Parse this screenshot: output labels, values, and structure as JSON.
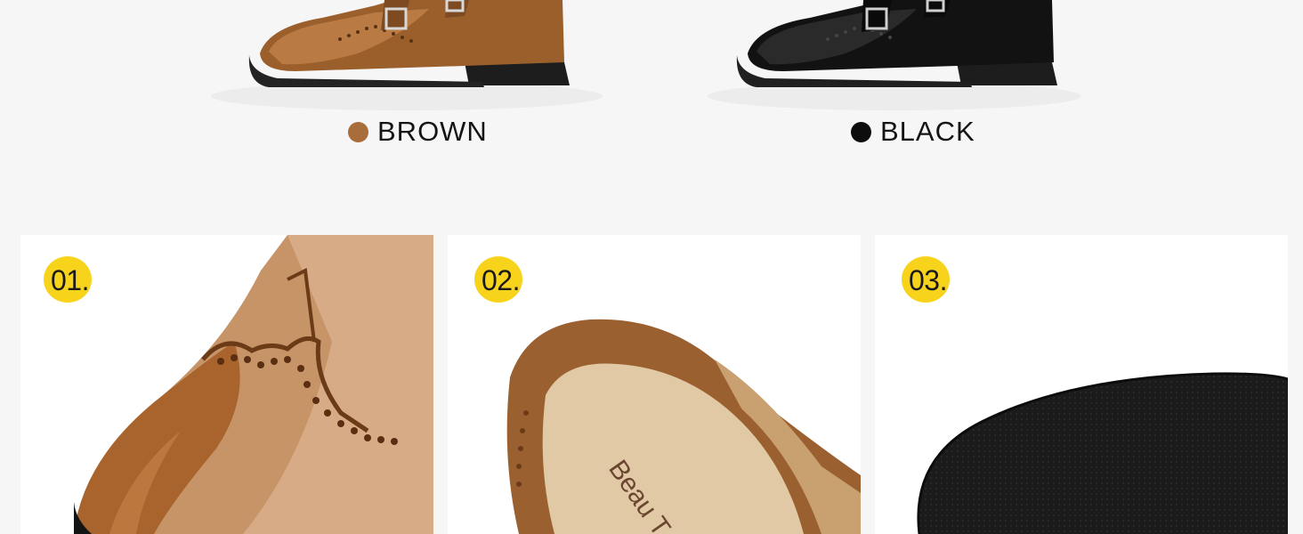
{
  "variants": [
    {
      "name": "BROWN",
      "dot_color": "#a86d3b",
      "image": "brown-brogue-monk-shoe"
    },
    {
      "name": "BLACK",
      "dot_color": "#0d0d0d",
      "image": "black-brogue-monk-shoe"
    }
  ],
  "features": [
    {
      "number": "01.",
      "image": "wingtip-toe-closeup"
    },
    {
      "number": "02.",
      "image": "insole-closeup",
      "insole_text": "Beau T"
    },
    {
      "number": "03.",
      "image": "rubber-outsole-closeup"
    }
  ],
  "colors": {
    "background": "#f6f6f6",
    "card": "#ffffff",
    "badge": "#f7d31c",
    "brown_leather": "#a86d3b",
    "black_leather": "#141414"
  }
}
